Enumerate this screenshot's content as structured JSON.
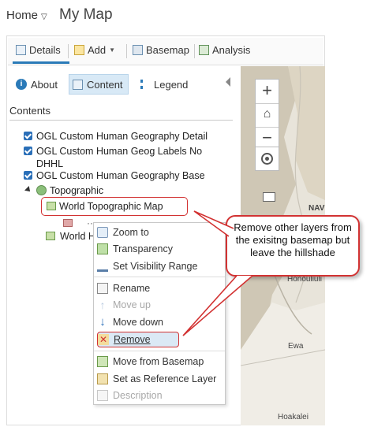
{
  "header": {
    "home_label": "Home",
    "map_title": "My Map"
  },
  "toolbar": {
    "details_label": "Details",
    "add_label": "Add",
    "basemap_label": "Basemap",
    "analysis_label": "Analysis"
  },
  "tabs": {
    "about_label": "About",
    "content_label": "Content",
    "legend_label": "Legend"
  },
  "contents": {
    "title": "Contents",
    "layers": [
      {
        "label": "OGL Custom Human Geography Detail",
        "checked": true
      },
      {
        "label": "OGL Custom Human Geog Labels No DHHL",
        "checked": true
      },
      {
        "label": "OGL Custom Human Geography Base",
        "checked": true
      }
    ],
    "basemap_group": "Topographic",
    "basemap_layers": [
      "World Topographic Map",
      "World H"
    ]
  },
  "menu": {
    "items": [
      {
        "label": "Zoom to",
        "icon": "zoom-to-icon",
        "disabled": false
      },
      {
        "label": "Transparency",
        "icon": "transparency-icon",
        "disabled": false
      },
      {
        "label": "Set Visibility Range",
        "icon": "visibility-range-icon",
        "disabled": false
      },
      {
        "label": "Rename",
        "icon": "rename-icon",
        "disabled": false
      },
      {
        "label": "Move up",
        "icon": "arrow-up-icon",
        "disabled": true
      },
      {
        "label": "Move down",
        "icon": "arrow-down-icon",
        "disabled": false
      },
      {
        "label": "Remove",
        "icon": "remove-icon",
        "disabled": false
      },
      {
        "label": "Move from Basemap",
        "icon": "move-from-basemap-icon",
        "disabled": false
      },
      {
        "label": "Set as Reference Layer",
        "icon": "reference-layer-icon",
        "disabled": false
      },
      {
        "label": "Description",
        "icon": "description-icon",
        "disabled": true
      }
    ]
  },
  "map": {
    "labels": [
      "NAV",
      "Honouliuli",
      "Ewa",
      "Hoakalei"
    ],
    "zoom_in": "+",
    "zoom_out": "−"
  },
  "callout": {
    "text": "Remove other layers from the exisitng basemap but leave the hillshade"
  },
  "colors": {
    "accent": "#2a7ab8",
    "highlight": "#d23232",
    "checkbox": "#2a6fb8"
  }
}
